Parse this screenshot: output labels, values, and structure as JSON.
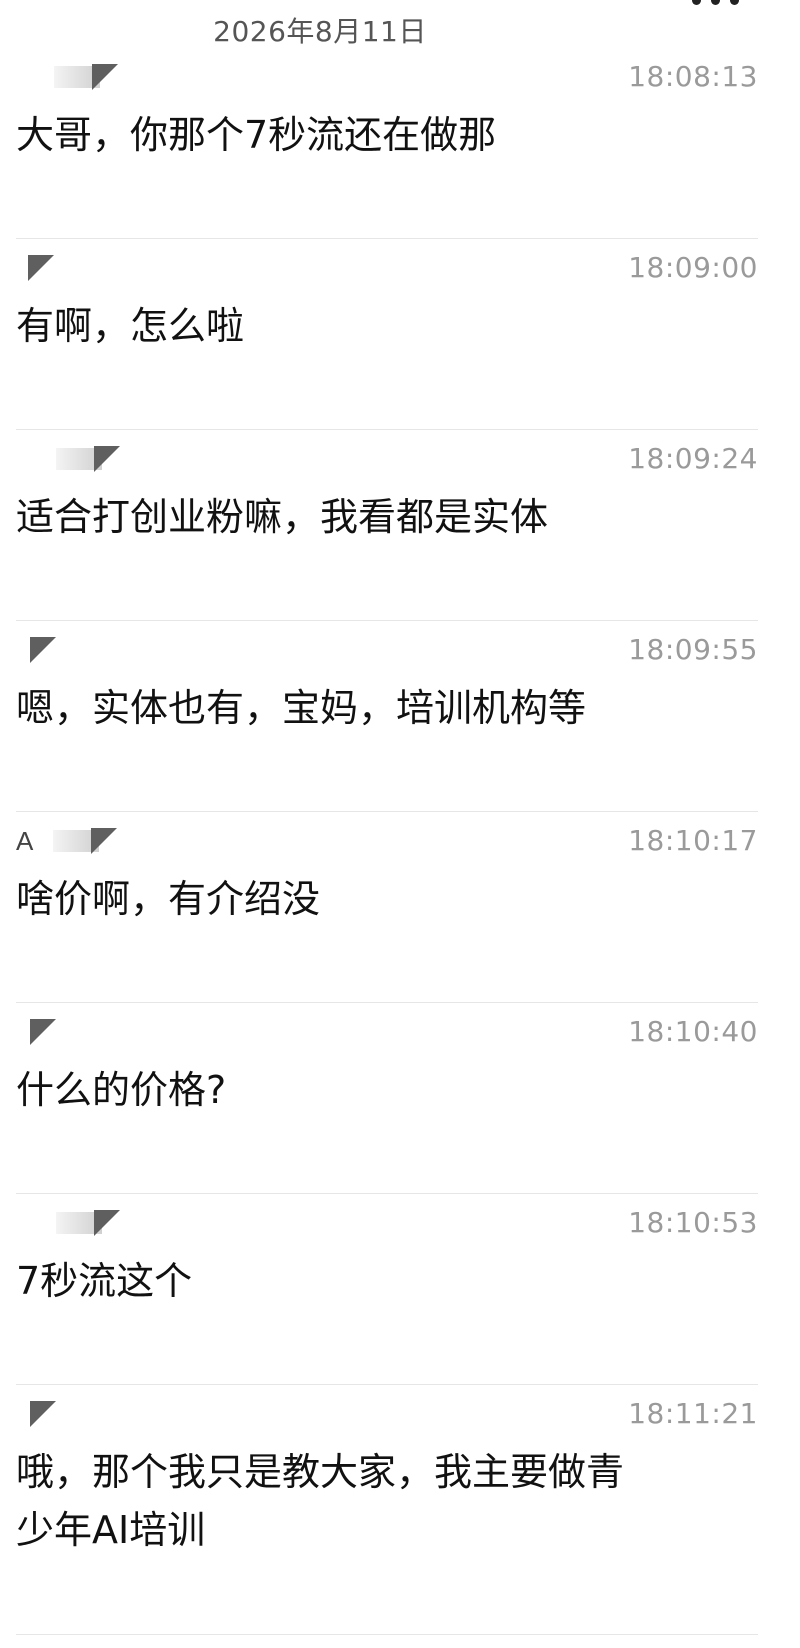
{
  "header": {
    "date": "2026年8月11日"
  },
  "messages": [
    {
      "sender_prefix": "",
      "time": "18:08:13",
      "text": "大哥，你那个7秒流还在做那"
    },
    {
      "sender_prefix": "",
      "time": "18:09:00",
      "text": "有啊，怎么啦"
    },
    {
      "sender_prefix": "",
      "time": "18:09:24",
      "text": "适合打创业粉嘛，我看都是实体"
    },
    {
      "sender_prefix": "",
      "time": "18:09:55",
      "text": "嗯，实体也有，宝妈，培训机构等"
    },
    {
      "sender_prefix": "A",
      "time": "18:10:17",
      "text": "啥价啊，有介绍没"
    },
    {
      "sender_prefix": "",
      "time": "18:10:40",
      "text": "什么的价格?"
    },
    {
      "sender_prefix": "",
      "time": "18:10:53",
      "text": "7秒流这个"
    },
    {
      "sender_prefix": "",
      "time": "18:11:21",
      "text": "哦，那个我只是教大家，我主要做青\n少年AI培训"
    }
  ],
  "icons": {
    "more": "more-dots-icon",
    "avatar": "redacted-avatar-icon"
  }
}
